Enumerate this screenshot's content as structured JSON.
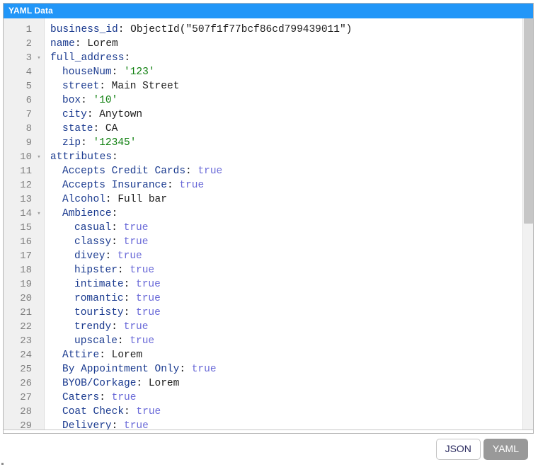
{
  "panel": {
    "title": "YAML Data"
  },
  "editor": {
    "mode": "yaml",
    "first_visible_line": 1,
    "last_visible_line": 29,
    "colors": {
      "title_bar": "#2196f8",
      "gutter": "#f0f0f0",
      "line_number": "#808080",
      "key": "#1a3a8f",
      "string": "#108010",
      "boolean": "#6a6ad8",
      "plain": "#1c1c1c",
      "scrollbar_thumb": "#c6c6c6",
      "active_button": "#999999"
    },
    "fold_icon": "▾",
    "lines": [
      {
        "n": "1",
        "fold": false,
        "indent": 0,
        "tokens": [
          {
            "t": "business_id",
            "c": "key"
          },
          {
            "t": ": ",
            "c": "punct"
          },
          {
            "t": "ObjectId(\"507f1f77bcf86cd799439011\")",
            "c": "plain"
          }
        ]
      },
      {
        "n": "2",
        "fold": false,
        "indent": 0,
        "tokens": [
          {
            "t": "name",
            "c": "key"
          },
          {
            "t": ": ",
            "c": "punct"
          },
          {
            "t": "Lorem",
            "c": "plain"
          }
        ]
      },
      {
        "n": "3",
        "fold": true,
        "indent": 0,
        "tokens": [
          {
            "t": "full_address",
            "c": "key"
          },
          {
            "t": ":",
            "c": "punct"
          }
        ]
      },
      {
        "n": "4",
        "fold": false,
        "indent": 1,
        "tokens": [
          {
            "t": "houseNum",
            "c": "key"
          },
          {
            "t": ": ",
            "c": "punct"
          },
          {
            "t": "'123'",
            "c": "str"
          }
        ]
      },
      {
        "n": "5",
        "fold": false,
        "indent": 1,
        "tokens": [
          {
            "t": "street",
            "c": "key"
          },
          {
            "t": ": ",
            "c": "punct"
          },
          {
            "t": "Main Street",
            "c": "plain"
          }
        ]
      },
      {
        "n": "6",
        "fold": false,
        "indent": 1,
        "tokens": [
          {
            "t": "box",
            "c": "key"
          },
          {
            "t": ": ",
            "c": "punct"
          },
          {
            "t": "'10'",
            "c": "str"
          }
        ]
      },
      {
        "n": "7",
        "fold": false,
        "indent": 1,
        "tokens": [
          {
            "t": "city",
            "c": "key"
          },
          {
            "t": ": ",
            "c": "punct"
          },
          {
            "t": "Anytown",
            "c": "plain"
          }
        ]
      },
      {
        "n": "8",
        "fold": false,
        "indent": 1,
        "tokens": [
          {
            "t": "state",
            "c": "key"
          },
          {
            "t": ": ",
            "c": "punct"
          },
          {
            "t": "CA",
            "c": "plain"
          }
        ]
      },
      {
        "n": "9",
        "fold": false,
        "indent": 1,
        "tokens": [
          {
            "t": "zip",
            "c": "key"
          },
          {
            "t": ": ",
            "c": "punct"
          },
          {
            "t": "'12345'",
            "c": "str"
          }
        ]
      },
      {
        "n": "10",
        "fold": true,
        "indent": 0,
        "tokens": [
          {
            "t": "attributes",
            "c": "key"
          },
          {
            "t": ":",
            "c": "punct"
          }
        ]
      },
      {
        "n": "11",
        "fold": false,
        "indent": 1,
        "tokens": [
          {
            "t": "Accepts Credit Cards",
            "c": "key"
          },
          {
            "t": ": ",
            "c": "punct"
          },
          {
            "t": "true",
            "c": "bool"
          }
        ]
      },
      {
        "n": "12",
        "fold": false,
        "indent": 1,
        "tokens": [
          {
            "t": "Accepts Insurance",
            "c": "key"
          },
          {
            "t": ": ",
            "c": "punct"
          },
          {
            "t": "true",
            "c": "bool"
          }
        ]
      },
      {
        "n": "13",
        "fold": false,
        "indent": 1,
        "tokens": [
          {
            "t": "Alcohol",
            "c": "key"
          },
          {
            "t": ": ",
            "c": "punct"
          },
          {
            "t": "Full bar",
            "c": "plain"
          }
        ]
      },
      {
        "n": "14",
        "fold": true,
        "indent": 1,
        "tokens": [
          {
            "t": "Ambience",
            "c": "key"
          },
          {
            "t": ":",
            "c": "punct"
          }
        ]
      },
      {
        "n": "15",
        "fold": false,
        "indent": 2,
        "tokens": [
          {
            "t": "casual",
            "c": "key"
          },
          {
            "t": ": ",
            "c": "punct"
          },
          {
            "t": "true",
            "c": "bool"
          }
        ]
      },
      {
        "n": "16",
        "fold": false,
        "indent": 2,
        "tokens": [
          {
            "t": "classy",
            "c": "key"
          },
          {
            "t": ": ",
            "c": "punct"
          },
          {
            "t": "true",
            "c": "bool"
          }
        ]
      },
      {
        "n": "17",
        "fold": false,
        "indent": 2,
        "tokens": [
          {
            "t": "divey",
            "c": "key"
          },
          {
            "t": ": ",
            "c": "punct"
          },
          {
            "t": "true",
            "c": "bool"
          }
        ]
      },
      {
        "n": "18",
        "fold": false,
        "indent": 2,
        "tokens": [
          {
            "t": "hipster",
            "c": "key"
          },
          {
            "t": ": ",
            "c": "punct"
          },
          {
            "t": "true",
            "c": "bool"
          }
        ]
      },
      {
        "n": "19",
        "fold": false,
        "indent": 2,
        "tokens": [
          {
            "t": "intimate",
            "c": "key"
          },
          {
            "t": ": ",
            "c": "punct"
          },
          {
            "t": "true",
            "c": "bool"
          }
        ]
      },
      {
        "n": "20",
        "fold": false,
        "indent": 2,
        "tokens": [
          {
            "t": "romantic",
            "c": "key"
          },
          {
            "t": ": ",
            "c": "punct"
          },
          {
            "t": "true",
            "c": "bool"
          }
        ]
      },
      {
        "n": "21",
        "fold": false,
        "indent": 2,
        "tokens": [
          {
            "t": "touristy",
            "c": "key"
          },
          {
            "t": ": ",
            "c": "punct"
          },
          {
            "t": "true",
            "c": "bool"
          }
        ]
      },
      {
        "n": "22",
        "fold": false,
        "indent": 2,
        "tokens": [
          {
            "t": "trendy",
            "c": "key"
          },
          {
            "t": ": ",
            "c": "punct"
          },
          {
            "t": "true",
            "c": "bool"
          }
        ]
      },
      {
        "n": "23",
        "fold": false,
        "indent": 2,
        "tokens": [
          {
            "t": "upscale",
            "c": "key"
          },
          {
            "t": ": ",
            "c": "punct"
          },
          {
            "t": "true",
            "c": "bool"
          }
        ]
      },
      {
        "n": "24",
        "fold": false,
        "indent": 1,
        "tokens": [
          {
            "t": "Attire",
            "c": "key"
          },
          {
            "t": ": ",
            "c": "punct"
          },
          {
            "t": "Lorem",
            "c": "plain"
          }
        ]
      },
      {
        "n": "25",
        "fold": false,
        "indent": 1,
        "tokens": [
          {
            "t": "By Appointment Only",
            "c": "key"
          },
          {
            "t": ": ",
            "c": "punct"
          },
          {
            "t": "true",
            "c": "bool"
          }
        ]
      },
      {
        "n": "26",
        "fold": false,
        "indent": 1,
        "tokens": [
          {
            "t": "BYOB/Corkage",
            "c": "key"
          },
          {
            "t": ": ",
            "c": "punct"
          },
          {
            "t": "Lorem",
            "c": "plain"
          }
        ]
      },
      {
        "n": "27",
        "fold": false,
        "indent": 1,
        "tokens": [
          {
            "t": "Caters",
            "c": "key"
          },
          {
            "t": ": ",
            "c": "punct"
          },
          {
            "t": "true",
            "c": "bool"
          }
        ]
      },
      {
        "n": "28",
        "fold": false,
        "indent": 1,
        "tokens": [
          {
            "t": "Coat Check",
            "c": "key"
          },
          {
            "t": ": ",
            "c": "punct"
          },
          {
            "t": "true",
            "c": "bool"
          }
        ]
      },
      {
        "n": "29",
        "fold": false,
        "indent": 1,
        "tokens": [
          {
            "t": "Delivery",
            "c": "key"
          },
          {
            "t": ": ",
            "c": "punct"
          },
          {
            "t": "true",
            "c": "bool"
          }
        ]
      }
    ]
  },
  "footer": {
    "buttons": [
      {
        "label": "JSON",
        "active": false
      },
      {
        "label": "YAML",
        "active": true
      }
    ]
  }
}
